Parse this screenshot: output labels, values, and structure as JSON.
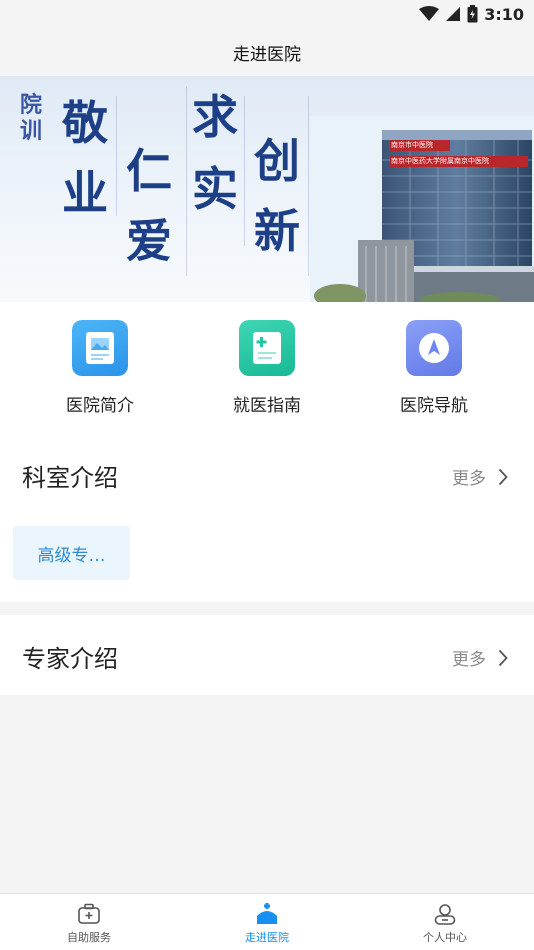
{
  "status_bar": {
    "time": "3:10"
  },
  "header": {
    "title": "走进医院"
  },
  "banner": {
    "motto": "院训",
    "chars": [
      "敬",
      "业",
      "仁",
      "爱",
      "求",
      "实",
      "创",
      "新"
    ],
    "building_sign_1": "南京市中医院",
    "building_sign_2": "南京中医药大学附属南京中医院"
  },
  "quick_entries": [
    {
      "label": "医院简介",
      "icon": "document-image-icon",
      "color": "#2f9ef0"
    },
    {
      "label": "就医指南",
      "icon": "medical-document-icon",
      "color": "#22c4a4"
    },
    {
      "label": "医院导航",
      "icon": "navigation-compass-icon",
      "color": "#6f86f0"
    }
  ],
  "departments": {
    "title": "科室介绍",
    "more_label": "更多",
    "items": [
      "高级专…"
    ]
  },
  "experts": {
    "title": "专家介绍",
    "more_label": "更多"
  },
  "bottom_nav": {
    "items": [
      {
        "label": "自助服务",
        "icon": "medical-kit-icon",
        "active": false
      },
      {
        "label": "走进医院",
        "icon": "hospital-icon",
        "active": true
      },
      {
        "label": "个人中心",
        "icon": "user-icon",
        "active": false
      }
    ]
  },
  "colors": {
    "accent": "#1a8ff0",
    "tag_bg": "#ebf5fd",
    "tag_text": "#2a8bd8"
  }
}
